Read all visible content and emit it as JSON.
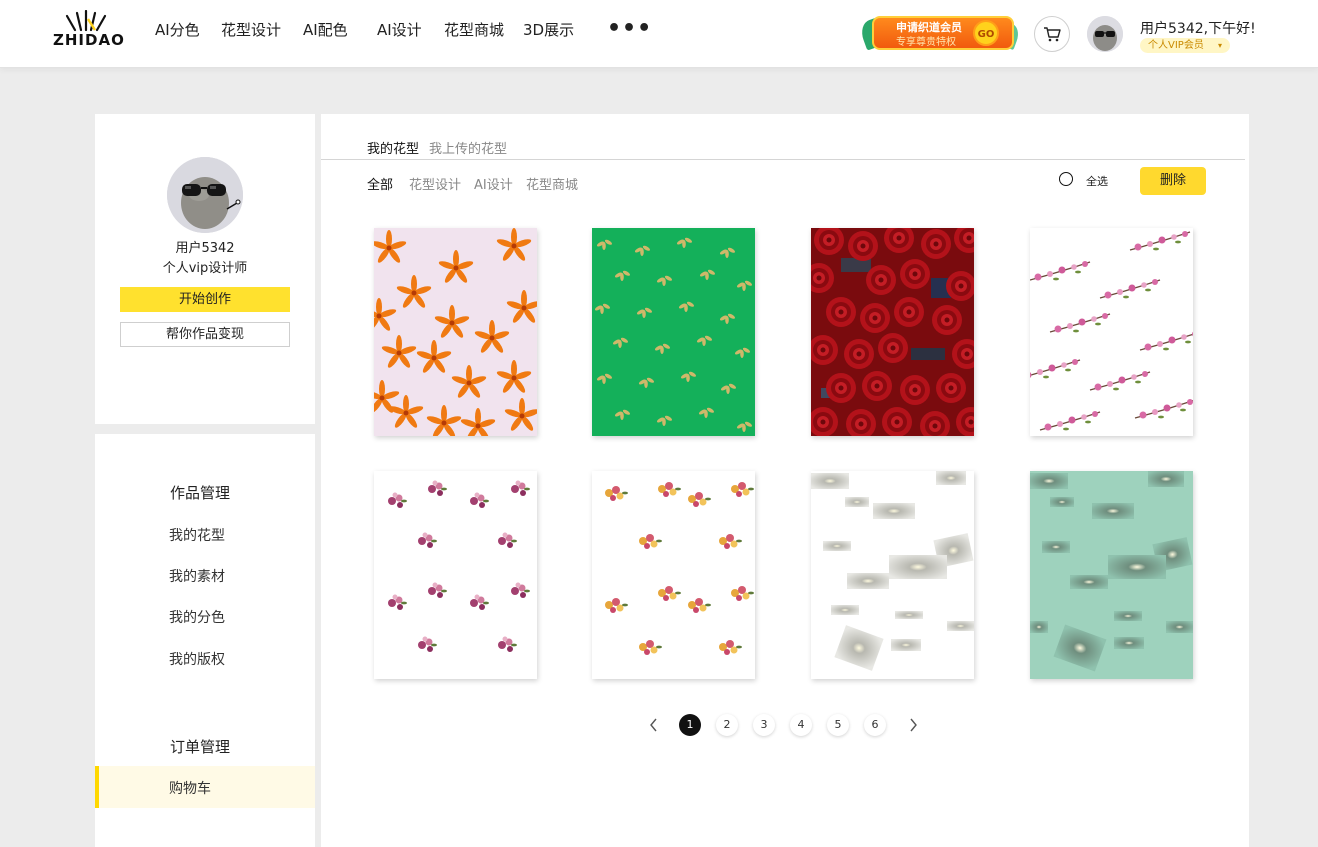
{
  "header": {
    "logo_text": "ZHIDAO",
    "nav": [
      {
        "label": "AI分色"
      },
      {
        "label": "花型设计"
      },
      {
        "label": "AI配色"
      },
      {
        "label": "AI设计"
      },
      {
        "label": "花型商城"
      },
      {
        "label": "3D展示"
      }
    ],
    "more_label": "•••",
    "vip_banner": {
      "line1": "申请织道会员",
      "line2": "专享尊贵特权",
      "go": "GO"
    },
    "cart_icon": "cart-icon",
    "user_greeting": "用户5342,下午好!",
    "vip_level": "个人VIP会员"
  },
  "profile": {
    "name": "用户5342",
    "role": "个人vip设计师",
    "start_button": "开始创作",
    "monetize_button": "帮你作品变现"
  },
  "sidebar": {
    "works_heading": "作品管理",
    "works_items": [
      {
        "label": "我的花型"
      },
      {
        "label": "我的素材"
      },
      {
        "label": "我的分色"
      },
      {
        "label": "我的版权"
      }
    ],
    "orders_heading": "订单管理",
    "orders_items": [
      {
        "label": "购物车",
        "active": true
      }
    ]
  },
  "main": {
    "tabs": [
      {
        "label": "我的花型",
        "active": true
      },
      {
        "label": "我上传的花型",
        "active": false
      }
    ],
    "filters": [
      {
        "label": "全部",
        "active": true
      },
      {
        "label": "花型设计",
        "active": false
      },
      {
        "label": "AI设计",
        "active": false
      },
      {
        "label": "花型商城",
        "active": false
      }
    ],
    "select_all_label": "全选",
    "delete_button": "删除",
    "patterns": [
      {
        "type": "orange-lily",
        "background": "#f1e3ee"
      },
      {
        "type": "golden-leaf",
        "background": "#14b05a"
      },
      {
        "type": "red-rose",
        "background": "#9a0e10"
      },
      {
        "type": "pink-blossom-branch",
        "background": "#ffffff"
      },
      {
        "type": "mauve-floral-cluster",
        "background": "#ffffff"
      },
      {
        "type": "warm-floral-cluster",
        "background": "#ffffff"
      },
      {
        "type": "grey-glow-tiles",
        "background": "#ffffff"
      },
      {
        "type": "grey-glow-tiles",
        "background": "#9ed2bd"
      }
    ],
    "pagination": {
      "current": 1,
      "pages": [
        "1",
        "2",
        "3",
        "4",
        "5",
        "6"
      ]
    }
  },
  "colors": {
    "accent_yellow": "#ffd92e",
    "active_row_bg": "#fffae6",
    "dark": "#111111"
  }
}
